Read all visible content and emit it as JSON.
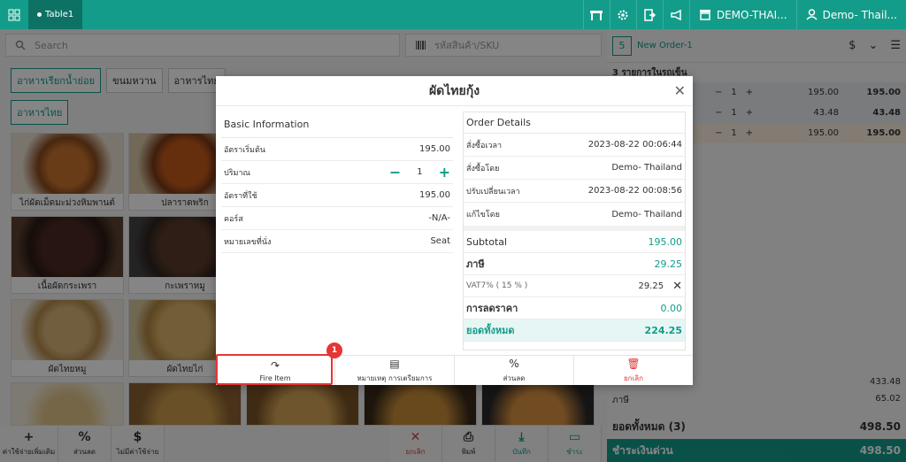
{
  "topbar": {
    "table_tab": "Table1",
    "branch": "DEMO-THAI...",
    "user": "Demo- Thail..."
  },
  "search": {
    "placeholder": "Search",
    "sku_placeholder": "รหัสสินค้า/SKU"
  },
  "categories": [
    "อาหารเรียกน้ำย่อย",
    "ขนมหวาน",
    "อาหารไทย"
  ],
  "category_row2": "อาหารไทย",
  "products": [
    {
      "name": "ไก่ผัดเม็ดมะม่วงหิมพานต์"
    },
    {
      "name": "ปลาราดพริก"
    },
    {
      "name": "เนื้อผัดกระเพรา"
    },
    {
      "name": "กะเพราหมู"
    },
    {
      "name": "ผัดไทยหมู"
    },
    {
      "name": "ผัดไทยไก่"
    }
  ],
  "bottombar": {
    "extra_cost": "ค่าใช้จ่ายเพิ่มเติม",
    "discount": "ส่วนลด",
    "no_cost": "ไม่มีค่าใช้จ่าย",
    "cancel": "ยกเลิก",
    "print": "พิมพ์",
    "save": "บันทึก",
    "pay": "ชำระ"
  },
  "order": {
    "number": "5",
    "title": "New Order-1",
    "items_count_label": "3 รายการในรถเข็น",
    "lines": [
      {
        "qty": "1",
        "price": "195.00",
        "total": "195.00"
      },
      {
        "qty": "1",
        "price": "43.48",
        "total": "43.48"
      },
      {
        "qty": "1",
        "price": "195.00",
        "total": "195.00"
      }
    ],
    "subtotal_value": "433.48",
    "tax_label": "ภาษี",
    "tax_value": "65.02",
    "grand_label": "ยอดทั้งหมด  (3)",
    "grand_value": "498.50",
    "pay_label": "ชำระเงินด่วน",
    "pay_value": "498.50"
  },
  "modal": {
    "title": "ผัดไทยกุ้ง",
    "basic_title": "Basic Information",
    "basic": [
      {
        "key": "อัตราเริ่มต้น",
        "value": "195.00"
      },
      {
        "key": "ปริมาณ",
        "value": "1"
      },
      {
        "key": "อัตราที่ใช้",
        "value": "195.00"
      },
      {
        "key": "คอร์ส",
        "value": "-N/A-"
      },
      {
        "key": "หมายเลขที่นั่ง",
        "value": "Seat"
      }
    ],
    "order_title": "Order Details",
    "details": [
      {
        "key": "สั่งซื้อเวลา",
        "value": "2023-08-22 00:06:44"
      },
      {
        "key": "สั่งซื้อโดย",
        "value": "Demo- Thailand"
      },
      {
        "key": "ปรับเปลี่ยนเวลา",
        "value": "2023-08-22 00:08:56"
      },
      {
        "key": "แก้ไขโดย",
        "value": "Demo- Thailand"
      }
    ],
    "subtotal_label": "Subtotal",
    "subtotal_value": "195.00",
    "tax_label": "ภาษี",
    "tax_value": "29.25",
    "vat_label": "VAT7% ( 15 % )",
    "vat_value": "29.25",
    "discount_label": "การลดราคา",
    "discount_value": "0.00",
    "total_label": "ยอดทั้งหมด",
    "total_value": "224.25",
    "actions": {
      "fire": "Fire Item",
      "note": "หมายเหตุ การเตรียมการ",
      "discount": "ส่วนลด",
      "discount_icon": "%",
      "cancel": "ยกเลิก"
    }
  },
  "annotation_badge": "1",
  "colors": {
    "accent": "#139c8a",
    "danger": "#e53535"
  }
}
